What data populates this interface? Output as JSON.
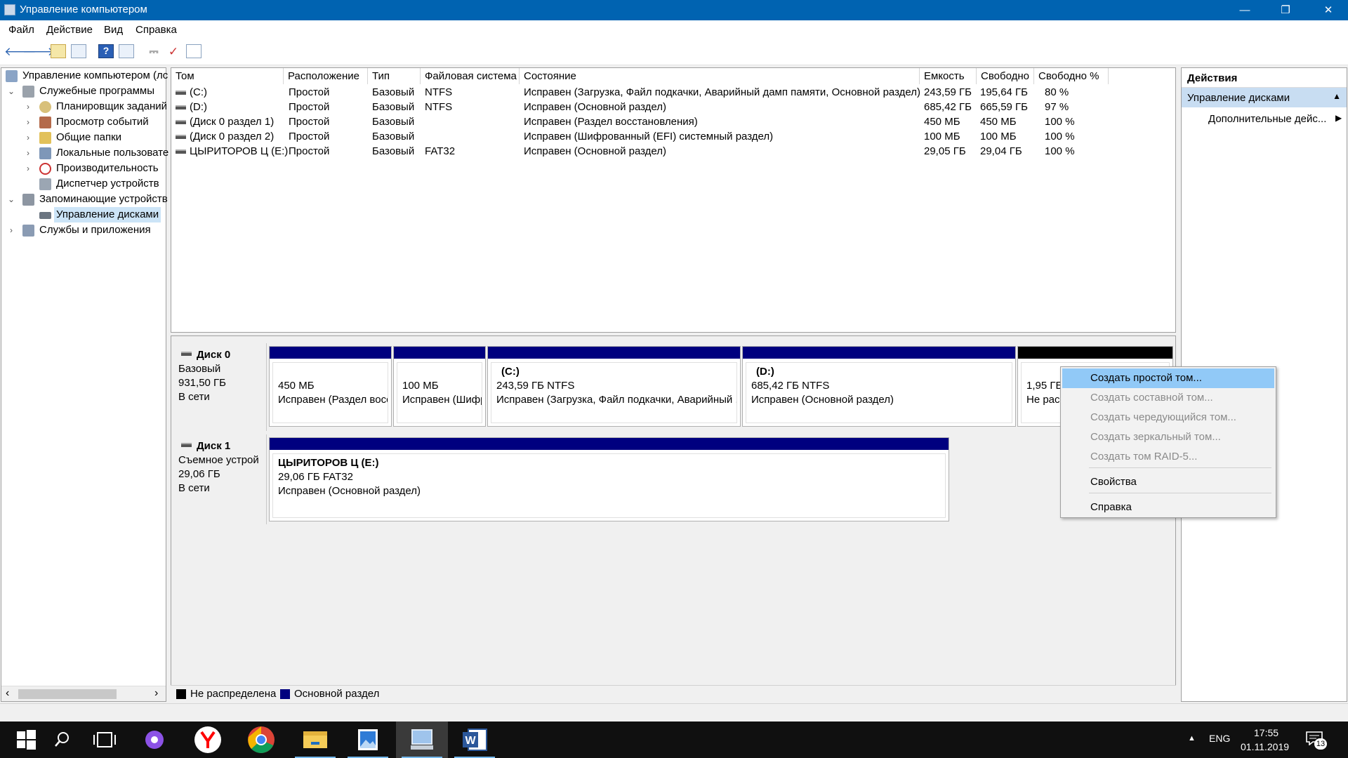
{
  "window": {
    "title": "Управление компьютером",
    "minimize": "—",
    "restore": "❐",
    "close": "✕"
  },
  "menu": [
    "Файл",
    "Действие",
    "Вид",
    "Справка"
  ],
  "toolbar": {
    "icons": [
      "back-arrow-icon",
      "forward-arrow-icon",
      "up-folder-icon",
      "show-tree-icon",
      "help-icon",
      "properties-icon",
      "connect-icon",
      "check-icon",
      "list-icon"
    ]
  },
  "tree": {
    "items": [
      {
        "label": "Управление компьютером (лс",
        "level": 0,
        "expander": ""
      },
      {
        "label": "Служебные программы",
        "level": 1,
        "expander": "⌄"
      },
      {
        "label": "Планировщик заданий",
        "level": 2,
        "expander": "›"
      },
      {
        "label": "Просмотр событий",
        "level": 2,
        "expander": "›"
      },
      {
        "label": "Общие папки",
        "level": 2,
        "expander": "›"
      },
      {
        "label": "Локальные пользовате",
        "level": 2,
        "expander": "›"
      },
      {
        "label": "Производительность",
        "level": 2,
        "expander": "›"
      },
      {
        "label": "Диспетчер устройств",
        "level": 2,
        "expander": ""
      },
      {
        "label": "Запоминающие устройств",
        "level": 1,
        "expander": "⌄"
      },
      {
        "label": "Управление дисками",
        "level": 2,
        "expander": "",
        "selected": true
      },
      {
        "label": "Службы и приложения",
        "level": 1,
        "expander": "›"
      }
    ],
    "scroll_left": "‹",
    "scroll_right": "›"
  },
  "volumes": {
    "columns": [
      "Том",
      "Расположение",
      "Тип",
      "Файловая система",
      "Состояние",
      "Емкость",
      "Свободно",
      "Свободно %"
    ],
    "rows": [
      [
        "(C:)",
        "Простой",
        "Базовый",
        "NTFS",
        "Исправен (Загрузка, Файл подкачки, Аварийный дамп памяти, Основной раздел)",
        "243,59 ГБ",
        "195,64 ГБ",
        "80 %"
      ],
      [
        "(D:)",
        "Простой",
        "Базовый",
        "NTFS",
        "Исправен (Основной раздел)",
        "685,42 ГБ",
        "665,59 ГБ",
        "97 %"
      ],
      [
        "(Диск 0 раздел 1)",
        "Простой",
        "Базовый",
        "",
        "Исправен (Раздел восстановления)",
        "450 МБ",
        "450 МБ",
        "100 %"
      ],
      [
        "(Диск 0 раздел 2)",
        "Простой",
        "Базовый",
        "",
        "Исправен (Шифрованный (EFI) системный раздел)",
        "100 МБ",
        "100 МБ",
        "100 %"
      ],
      [
        "ЦЫРИТОРОВ Ц (E:)",
        "Простой",
        "Базовый",
        "FAT32",
        "Исправен (Основной раздел)",
        "29,05 ГБ",
        "29,04 ГБ",
        "100 %"
      ]
    ]
  },
  "disks": [
    {
      "name": "Диск 0",
      "type": "Базовый",
      "size": "931,50 ГБ",
      "status": "В сети",
      "partitions": [
        {
          "title": "",
          "line1": "450 МБ",
          "line2": "Исправен (Раздел восс"
        },
        {
          "title": "",
          "line1": "100 МБ",
          "line2": "Исправен (Шифр"
        },
        {
          "title": "(C:)",
          "line1": "243,59 ГБ NTFS",
          "line2": "Исправен (Загрузка, Файл подкачки, Аварийный ,"
        },
        {
          "title": "(D:)",
          "line1": "685,42 ГБ NTFS",
          "line2": "Исправен (Основной раздел)"
        },
        {
          "title": "",
          "line1": "1,95 ГБ",
          "line2": "Не расп"
        }
      ]
    },
    {
      "name": "Диск 1",
      "type": "Съемное устрой",
      "size": "29,06 ГБ",
      "status": "В сети",
      "partitions": [
        {
          "title": "ЦЫРИТОРОВ Ц  (E:)",
          "line1": "29,06 ГБ FAT32",
          "line2": "Исправен (Основной раздел)"
        }
      ]
    }
  ],
  "legend": [
    {
      "label": "Не распределена",
      "color": "#000000"
    },
    {
      "label": "Основной раздел",
      "color": "#00007f"
    }
  ],
  "actions": {
    "header": "Действия",
    "section": "Управление дисками",
    "more": "Дополнительные дейс..."
  },
  "context_menu": [
    {
      "label": "Создать простой том...",
      "state": "highlighted"
    },
    {
      "label": "Создать составной том...",
      "state": "disabled"
    },
    {
      "label": "Создать чередующийся том...",
      "state": "disabled"
    },
    {
      "label": "Создать зеркальный том...",
      "state": "disabled"
    },
    {
      "label": "Создать том RAID-5...",
      "state": "disabled"
    },
    {
      "label": "Свойства",
      "state": "normal"
    },
    {
      "label": "Справка",
      "state": "normal"
    }
  ],
  "taskbar": {
    "apps": [
      "start-icon",
      "search-icon",
      "task-view-icon",
      "alice-icon",
      "yandex-browser-icon",
      "chrome-icon",
      "file-explorer-icon",
      "photos-icon",
      "computer-management-icon",
      "word-icon"
    ],
    "tray": {
      "language": "ENG",
      "time": "17:55",
      "date": "01.11.2019",
      "notifications": "13",
      "up_arrow": "▲"
    }
  }
}
